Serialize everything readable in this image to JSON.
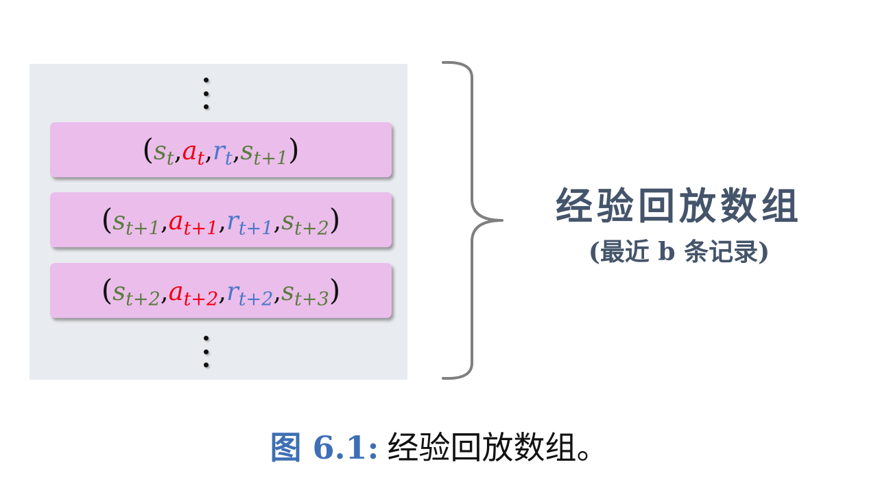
{
  "buffer": {
    "records": [
      {
        "state": "s",
        "state_sub": "t",
        "action": "a",
        "action_sub": "t",
        "reward": "r",
        "reward_sub": "t",
        "next_state": "s",
        "next_state_sub": "t+1"
      },
      {
        "state": "s",
        "state_sub": "t+1",
        "action": "a",
        "action_sub": "t+1",
        "reward": "r",
        "reward_sub": "t+1",
        "next_state": "s",
        "next_state_sub": "t+2"
      },
      {
        "state": "s",
        "state_sub": "t+2",
        "action": "a",
        "action_sub": "t+2",
        "reward": "r",
        "reward_sub": "t+2",
        "next_state": "s",
        "next_state_sub": "t+3"
      }
    ],
    "punct": {
      "open": "(",
      "close": ")",
      "sep": ","
    },
    "colors": {
      "state": "#5a7c3f",
      "action": "#f0000f",
      "reward": "#4a78c8",
      "record_bg": "#ebbdeb",
      "panel_bg": "#e8ebef"
    }
  },
  "label": {
    "title": "经验回放数组",
    "subtitle": "(最近 b 条记录)",
    "color": "#44546a"
  },
  "caption": {
    "prefix": "图 6.1:",
    "text": "经验回放数组。",
    "prefix_color": "#3e6fb5"
  }
}
